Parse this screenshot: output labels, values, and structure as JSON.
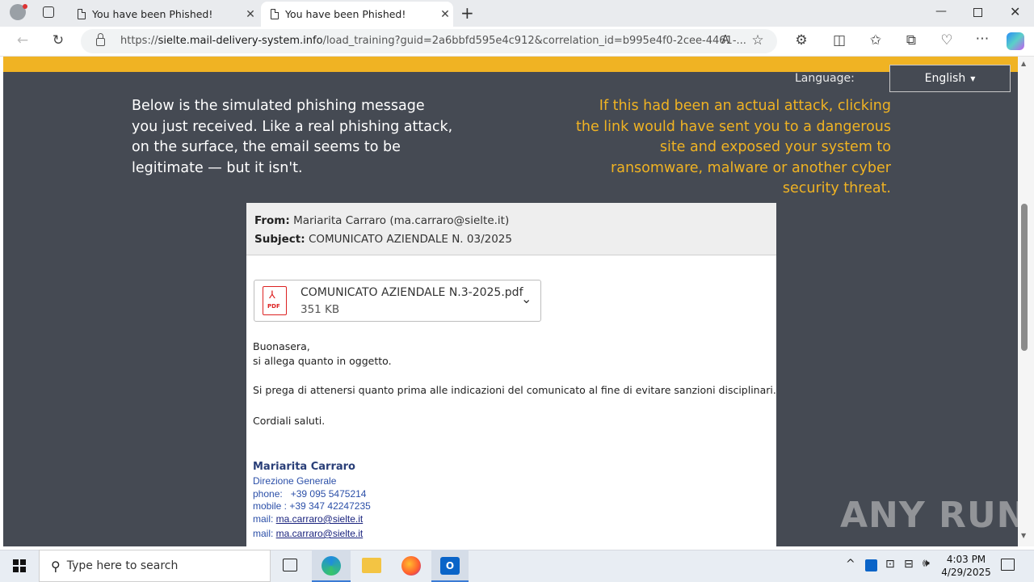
{
  "browser": {
    "tabs": [
      {
        "title": "You have been Phished!",
        "active": false
      },
      {
        "title": "You have been Phished!",
        "active": true
      }
    ],
    "url_domain": "sielte.mail-delivery-system.info",
    "url_rest": "/load_training?guid=2a6bbfd595e4c912&correlation_id=b995e4f0-2cee-4461-..."
  },
  "page": {
    "language_label": "Language:",
    "language_value": "English",
    "intro_left": "Below is the simulated phishing message you just received. Like a real phishing attack, on the surface, the email seems to be legitimate — but it isn't.",
    "intro_right": "If this had been an actual attack, clicking the link would have sent you to a dangerous site and exposed your system to ransomware, malware or another cyber security threat."
  },
  "email": {
    "from_label": "From:",
    "from_value": "Mariarita Carraro (ma.carraro@sielte.it)",
    "subject_label": "Subject:",
    "subject_value": "COMUNICATO AZIENDALE N. 03/2025",
    "attachment": {
      "name": "COMUNICATO AZIENDALE N.3-2025.pdf",
      "size": "351 KB",
      "icon_label": "PDF"
    },
    "greeting": "Buonasera,",
    "line1": "si allega quanto in oggetto.",
    "line2": "Si prega di attenersi quanto prima alle indicazioni del comunicato al fine di evitare sanzioni disciplinari.",
    "closing": "Cordiali saluti.",
    "signature": {
      "name": "Mariarita Carraro",
      "dept": "Direzione Generale",
      "phone": "phone:   +39 095 5475214",
      "mobile": "mobile : +39 347 42247235",
      "mail_label": "mail: ",
      "mail_value": "ma.carraro@sielte.it"
    }
  },
  "watermark": "ANY RUN",
  "taskbar": {
    "search_placeholder": "Type here to search",
    "time": "4:03 PM",
    "date": "4/29/2025"
  },
  "colors": {
    "accent_yellow": "#f0b323",
    "page_bg": "#454a53"
  }
}
